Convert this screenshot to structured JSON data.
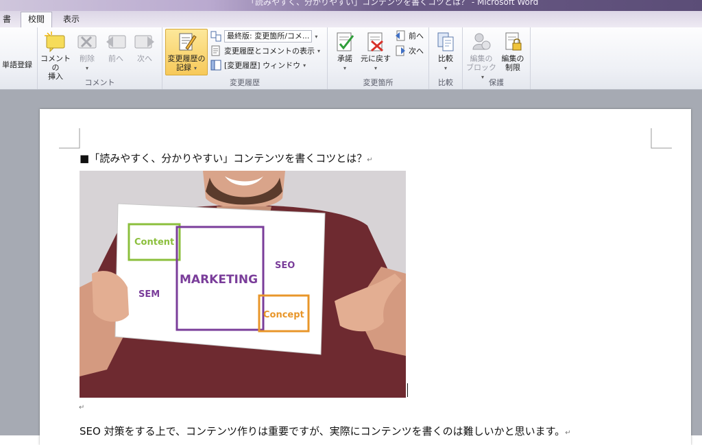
{
  "window": {
    "title": "「読みやすく、分かりやすい」コンテンツを書くコツとは？ - Microsoft Word"
  },
  "tabs": [
    {
      "label": "書",
      "active": false
    },
    {
      "label": "校閲",
      "active": true
    },
    {
      "label": "表示",
      "active": false
    }
  ],
  "ribbon": {
    "dictionary": {
      "label": "単語登録"
    },
    "comments": {
      "group_label": "コメント",
      "insert_line1": "コメントの",
      "insert_line2": "挿入",
      "delete_label": "削除",
      "prev_label": "前へ",
      "next_label": "次へ"
    },
    "tracking": {
      "group_label": "変更履歴",
      "track_line1": "変更履歴の",
      "track_line2": "記録",
      "display_combo": "最終版: 変更箇所/コメ...",
      "show_markup": "変更履歴とコメントの表示",
      "reviewing_pane": "[変更履歴] ウィンドウ"
    },
    "changes": {
      "group_label": "変更箇所",
      "accept_label": "承諾",
      "reject_label": "元に戻す",
      "prev_label": "前へ",
      "next_label": "次へ"
    },
    "compare": {
      "group_label": "比較",
      "compare_label": "比較"
    },
    "protect": {
      "group_label": "保護",
      "block_line1": "編集の",
      "block_line2": "ブロック",
      "restrict_line1": "編集の",
      "restrict_line2": "制限"
    }
  },
  "document": {
    "heading_bullet": "■",
    "heading": "「読みやすく、分かりやすい」コンテンツを書くコツとは？",
    "image_words": {
      "content": "Content",
      "marketing": "MARKETING",
      "seo": "SEO",
      "sem": "SEM",
      "concept": "Concept"
    },
    "paragraph_mark": "↵",
    "body": "SEO 対策をする上で、コンテンツ作りは重要ですが、実際にコンテンツを書くのは難しいかと思います。"
  },
  "colors": {
    "accent_green": "#8bbf3c",
    "accent_purple": "#7a3d9a",
    "accent_orange": "#e8962a",
    "ribbon_highlight": "#f7c95a"
  }
}
